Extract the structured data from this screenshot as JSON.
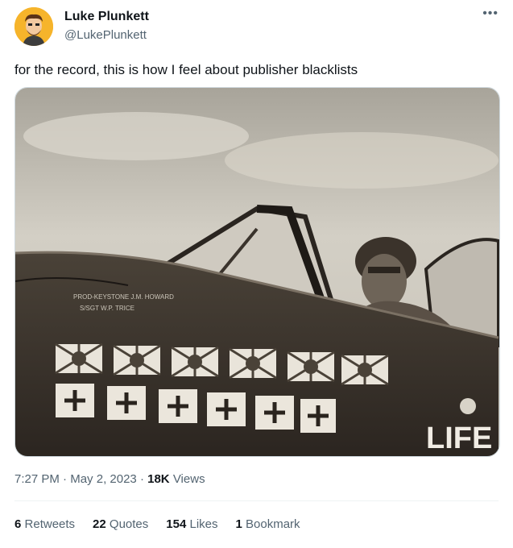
{
  "author": {
    "name": "Luke Plunkett",
    "handle": "@LukePlunkett"
  },
  "tweet": {
    "text": "for the record, this is how I feel about publisher blacklists"
  },
  "media": {
    "watermark": "LIFE",
    "plane_caption_line1": "PROD-KEYSTONE J.M. HOWARD",
    "plane_caption_line2": "S/SGT W.P. TRICE"
  },
  "meta": {
    "time": "7:27 PM",
    "date": "May 2, 2023",
    "views_count": "18K",
    "views_label": "Views"
  },
  "stats": {
    "retweets_count": "6",
    "retweets_label": "Retweets",
    "quotes_count": "22",
    "quotes_label": "Quotes",
    "likes_count": "154",
    "likes_label": "Likes",
    "bookmarks_count": "1",
    "bookmarks_label": "Bookmark"
  }
}
